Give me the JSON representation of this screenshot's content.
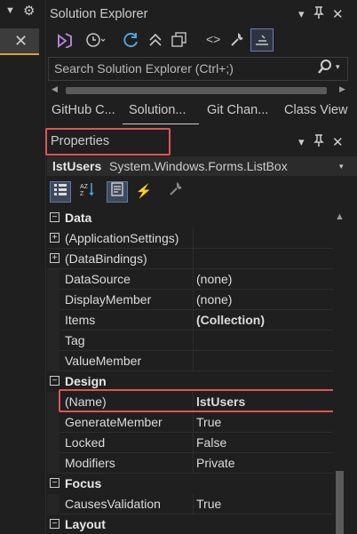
{
  "left": {
    "close_glyph": "✕",
    "dropdown_glyph": "▼",
    "gear_glyph": "⚙"
  },
  "solution_explorer": {
    "title": "Solution Explorer",
    "title_buttons": {
      "dropdown": "▾",
      "pin": "🖈",
      "close": "✕"
    },
    "toolbar_icons": [
      "vs-solution-icon",
      "history-icon",
      "sync-icon",
      "collapse-all-icon",
      "show-all-files-icon",
      "code-icon",
      "properties-wrench-icon",
      "preview-icon"
    ],
    "search": {
      "placeholder": "Search Solution Explorer (Ctrl+;)",
      "search_glyph": "⚲",
      "dd_glyph": "▾"
    },
    "scroll": {
      "left": "◀",
      "right": "▶"
    }
  },
  "tabs": [
    "GitHub C...",
    "Solution...",
    "Git Chan...",
    "Class View"
  ],
  "properties": {
    "title": "Properties",
    "title_buttons": {
      "dropdown": "▾",
      "pin": "🖈",
      "close": "✕"
    },
    "object_name": "lstUsers",
    "object_type": "System.Windows.Forms.ListBox",
    "object_dd": "▾",
    "toolbar": [
      {
        "name": "categorized-icon",
        "glyph": "▦",
        "active": true
      },
      {
        "name": "alphabetical-icon",
        "glyph": "↧",
        "active": false
      },
      {
        "name": "properties-page-icon",
        "glyph": "▤",
        "active": true
      },
      {
        "name": "events-icon",
        "glyph": "⚡",
        "active": false
      },
      {
        "name": "property-pages-wrench-icon",
        "glyph": "🔧",
        "active": false
      }
    ],
    "grid": [
      {
        "kind": "category",
        "label": "Data",
        "expander": "−"
      },
      {
        "kind": "prop",
        "name": "(ApplicationSettings)",
        "value": "",
        "expander": "+"
      },
      {
        "kind": "prop",
        "name": "(DataBindings)",
        "value": "",
        "expander": "+"
      },
      {
        "kind": "prop",
        "name": "DataSource",
        "value": "(none)"
      },
      {
        "kind": "prop",
        "name": "DisplayMember",
        "value": "(none)"
      },
      {
        "kind": "prop",
        "name": "Items",
        "value": "(Collection)",
        "bold": true
      },
      {
        "kind": "prop",
        "name": "Tag",
        "value": ""
      },
      {
        "kind": "prop",
        "name": "ValueMember",
        "value": ""
      },
      {
        "kind": "category",
        "label": "Design",
        "expander": "−"
      },
      {
        "kind": "prop",
        "name": "(Name)",
        "value": "lstUsers",
        "bold": true
      },
      {
        "kind": "prop",
        "name": "GenerateMember",
        "value": "True"
      },
      {
        "kind": "prop",
        "name": "Locked",
        "value": "False"
      },
      {
        "kind": "prop",
        "name": "Modifiers",
        "value": "Private"
      },
      {
        "kind": "category",
        "label": "Focus",
        "expander": "−"
      },
      {
        "kind": "prop",
        "name": "CausesValidation",
        "value": "True"
      },
      {
        "kind": "category",
        "label": "Layout",
        "expander": "−"
      }
    ],
    "scroll_up": "▲"
  },
  "colors": {
    "highlight": "#e05555",
    "background": "#1f1f1f",
    "tab_accent": "#d6a441"
  }
}
